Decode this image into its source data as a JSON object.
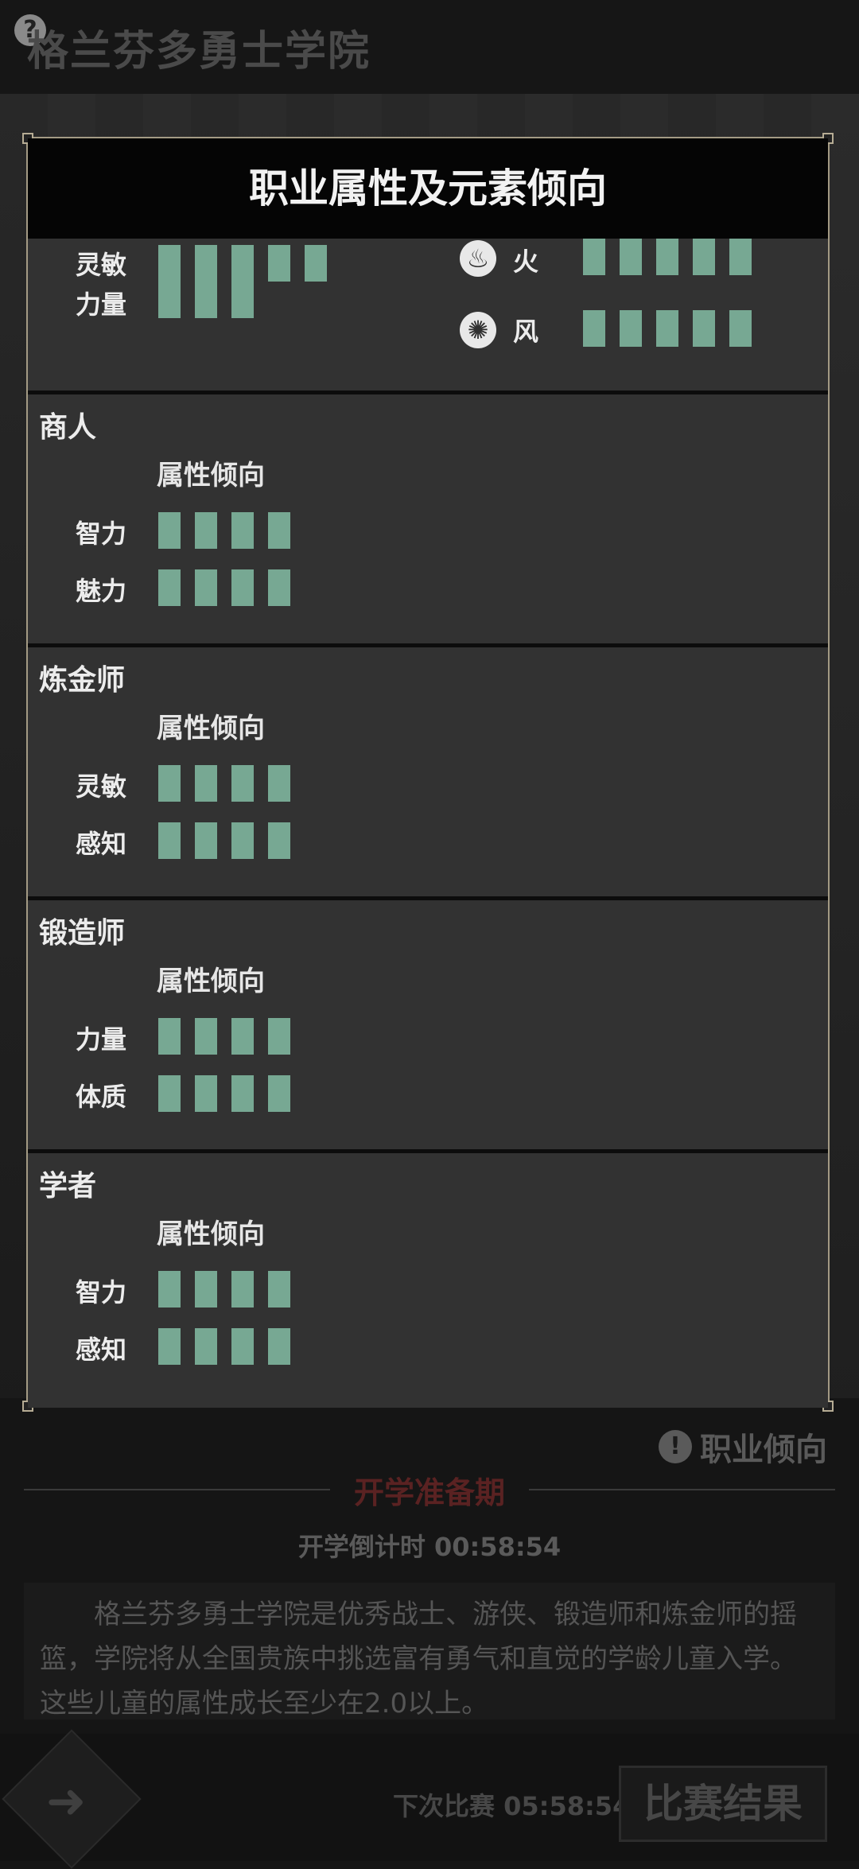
{
  "app": {
    "title": "格兰芬多勇士学院"
  },
  "background": {
    "tendency_label": "职业倾向",
    "phase_label": "开学准备期",
    "countdown_label": "开学倒计时 00:58:54",
    "description": "格兰芬多勇士学院是优秀战士、游侠、锻造师和炼金师的摇篮，学院将从全国贵族中挑选富有勇气和直觉的学龄儿童入学。这些儿童的属性成长至少在2.0以上。",
    "next_match": "下次比赛 05:58:54",
    "result_button": "比赛结果"
  },
  "modal": {
    "title": "职业属性及元素倾向",
    "partial_section": {
      "attributes": [
        {
          "label": "灵敏",
          "level": 5
        },
        {
          "label": "力量",
          "level": 3
        }
      ],
      "elements": [
        {
          "label": "火",
          "icon": "fire-element-icon",
          "level": 5
        },
        {
          "label": "风",
          "icon": "wind-element-icon",
          "level": 5
        }
      ]
    },
    "sections": [
      {
        "name": "商人",
        "subtitle": "属性倾向",
        "attributes": [
          {
            "label": "智力",
            "level": 4
          },
          {
            "label": "魅力",
            "level": 4
          }
        ]
      },
      {
        "name": "炼金师",
        "subtitle": "属性倾向",
        "attributes": [
          {
            "label": "灵敏",
            "level": 4
          },
          {
            "label": "感知",
            "level": 4
          }
        ]
      },
      {
        "name": "锻造师",
        "subtitle": "属性倾向",
        "attributes": [
          {
            "label": "力量",
            "level": 4
          },
          {
            "label": "体质",
            "level": 4
          }
        ]
      },
      {
        "name": "学者",
        "subtitle": "属性倾向",
        "attributes": [
          {
            "label": "智力",
            "level": 4
          },
          {
            "label": "感知",
            "level": 4
          }
        ]
      }
    ]
  },
  "colors": {
    "bar": "#77a893",
    "phase": "#5a2222"
  }
}
